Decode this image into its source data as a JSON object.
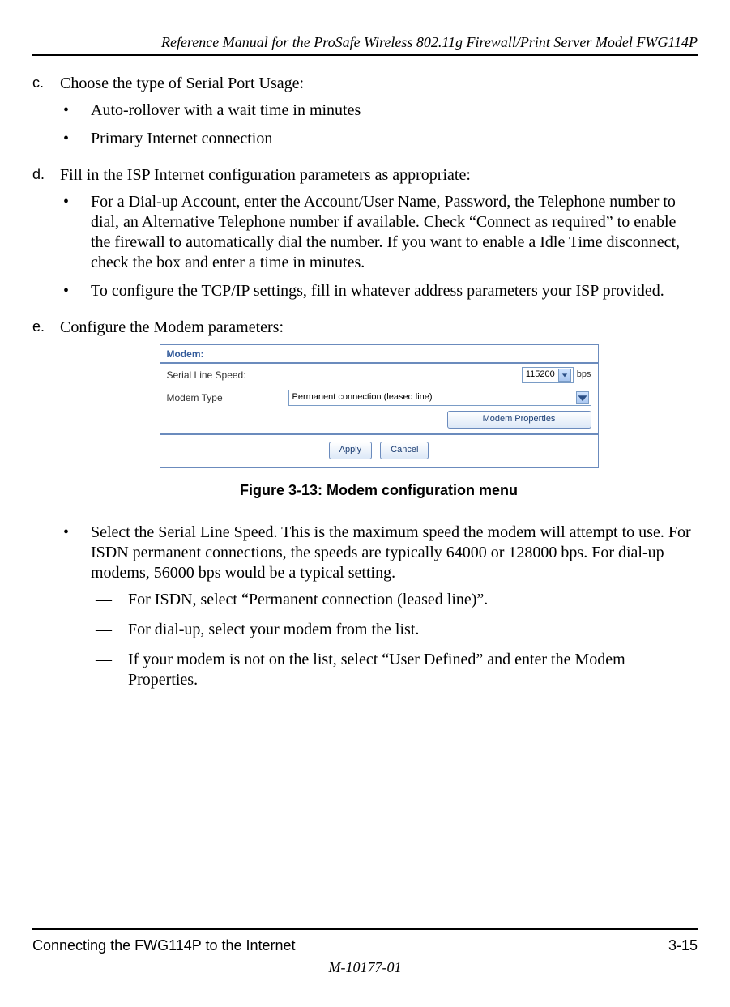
{
  "header": {
    "running_title": "Reference Manual for the ProSafe Wireless 802.11g  Firewall/Print Server Model FWG114P"
  },
  "items": {
    "c": {
      "marker": "c.",
      "text": "Choose the type of Serial Port Usage:",
      "bullets": [
        "Auto-rollover with a wait time in minutes",
        "Primary Internet connection"
      ]
    },
    "d": {
      "marker": "d.",
      "text": "Fill in the ISP Internet configuration parameters as appropriate:",
      "bullets": [
        "For a Dial-up Account, enter the Account/User Name, Password, the Telephone number to dial, an Alternative Telephone number if available. Check “Connect as required” to enable the firewall to automatically dial the number. If you want to enable a Idle Time disconnect, check the box and enter a time in minutes.",
        "To configure the TCP/IP settings, fill in whatever address parameters your ISP provided."
      ]
    },
    "e": {
      "marker": "e.",
      "text": "Configure the Modem parameters:"
    }
  },
  "modem_panel": {
    "title": "Modem:",
    "serial_line_speed_label": "Serial Line Speed:",
    "serial_line_speed_value": "115200",
    "bps_label": "bps",
    "modem_type_label": "Modem Type",
    "modem_type_value": "Permanent connection (leased line)",
    "modem_properties_button": "Modem Properties",
    "apply_button": "Apply",
    "cancel_button": "Cancel"
  },
  "figure_caption": "Figure 3-13: Modem configuration menu",
  "post_figure": {
    "bullet_main": "Select the Serial Line Speed. This is the maximum speed the modem will attempt to use. For ISDN permanent connections, the speeds are typically 64000 or 128000 bps. For dial-up modems, 56000 bps would be a typical setting.",
    "dashes": [
      "For ISDN, select “Permanent connection (leased line)”.",
      "For dial-up, select your modem from the list.",
      "If your modem is not on the list, select “User Defined” and enter the Modem Properties."
    ]
  },
  "footer": {
    "left": "Connecting the FWG114P to the Internet",
    "right": "3-15",
    "center": "M-10177-01"
  }
}
